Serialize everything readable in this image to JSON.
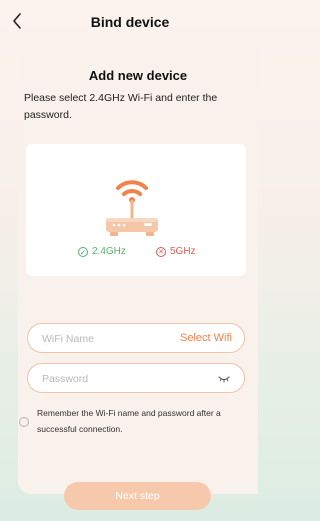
{
  "header": {
    "title": "Bind device",
    "back_icon": "chevron-left-icon"
  },
  "card": {
    "subtitle": "Add new device",
    "instruction": "Please select 2.4GHz Wi-Fi and enter the password."
  },
  "illustration": {
    "icon": "router-wifi-icon",
    "bands": [
      {
        "label": "2.4GHz",
        "status": "supported",
        "icon": "check-circle-icon",
        "color": "#52b36b"
      },
      {
        "label": "5GHz",
        "status": "unsupported",
        "icon": "x-circle-icon",
        "color": "#e05a5a"
      }
    ]
  },
  "form": {
    "wifi_placeholder": "WiFi Name",
    "wifi_value": "",
    "select_wifi_label": "Select Wifi",
    "password_placeholder": "Password",
    "password_value": "",
    "password_toggle_icon": "eye-closed-icon"
  },
  "remember": {
    "label": "Remember the Wi-Fi name and password after a successful connection.",
    "checked": false
  },
  "next_button": {
    "label": "Next step"
  },
  "colors": {
    "accent": "#f0824a",
    "accent_light": "#f6c9ad",
    "field_border": "#f1c4a8",
    "ok": "#52b36b",
    "error": "#e05a5a"
  }
}
